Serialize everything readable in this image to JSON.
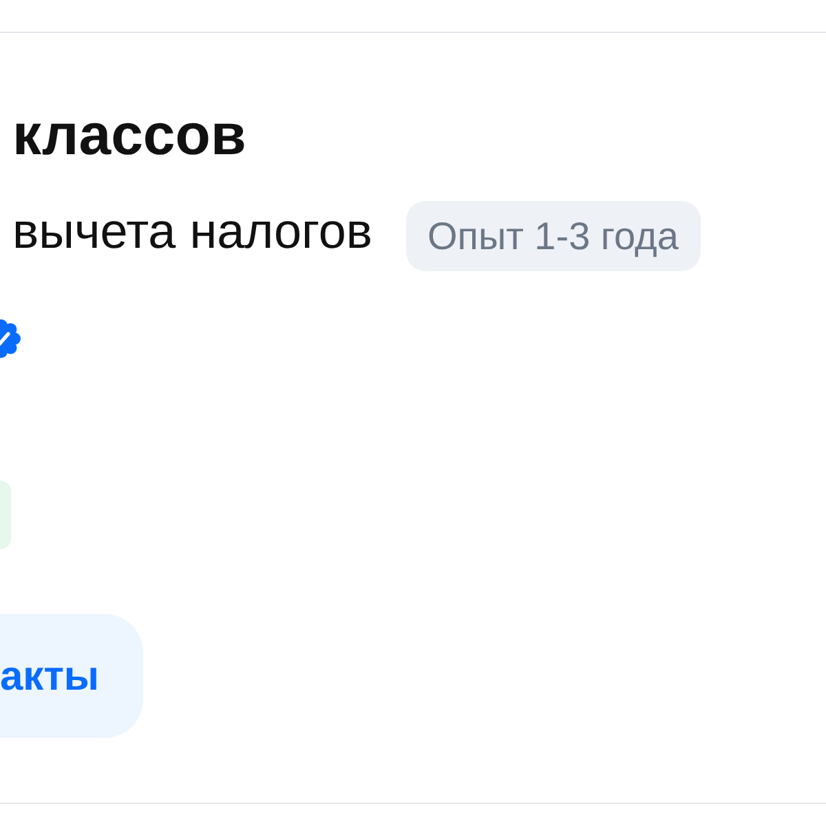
{
  "vacancy": {
    "title": "классов",
    "description": "вычета налогов",
    "experience": "Опыт 1-3 года",
    "employer_verified": true
  },
  "contacts_button": {
    "label": "акты"
  }
}
